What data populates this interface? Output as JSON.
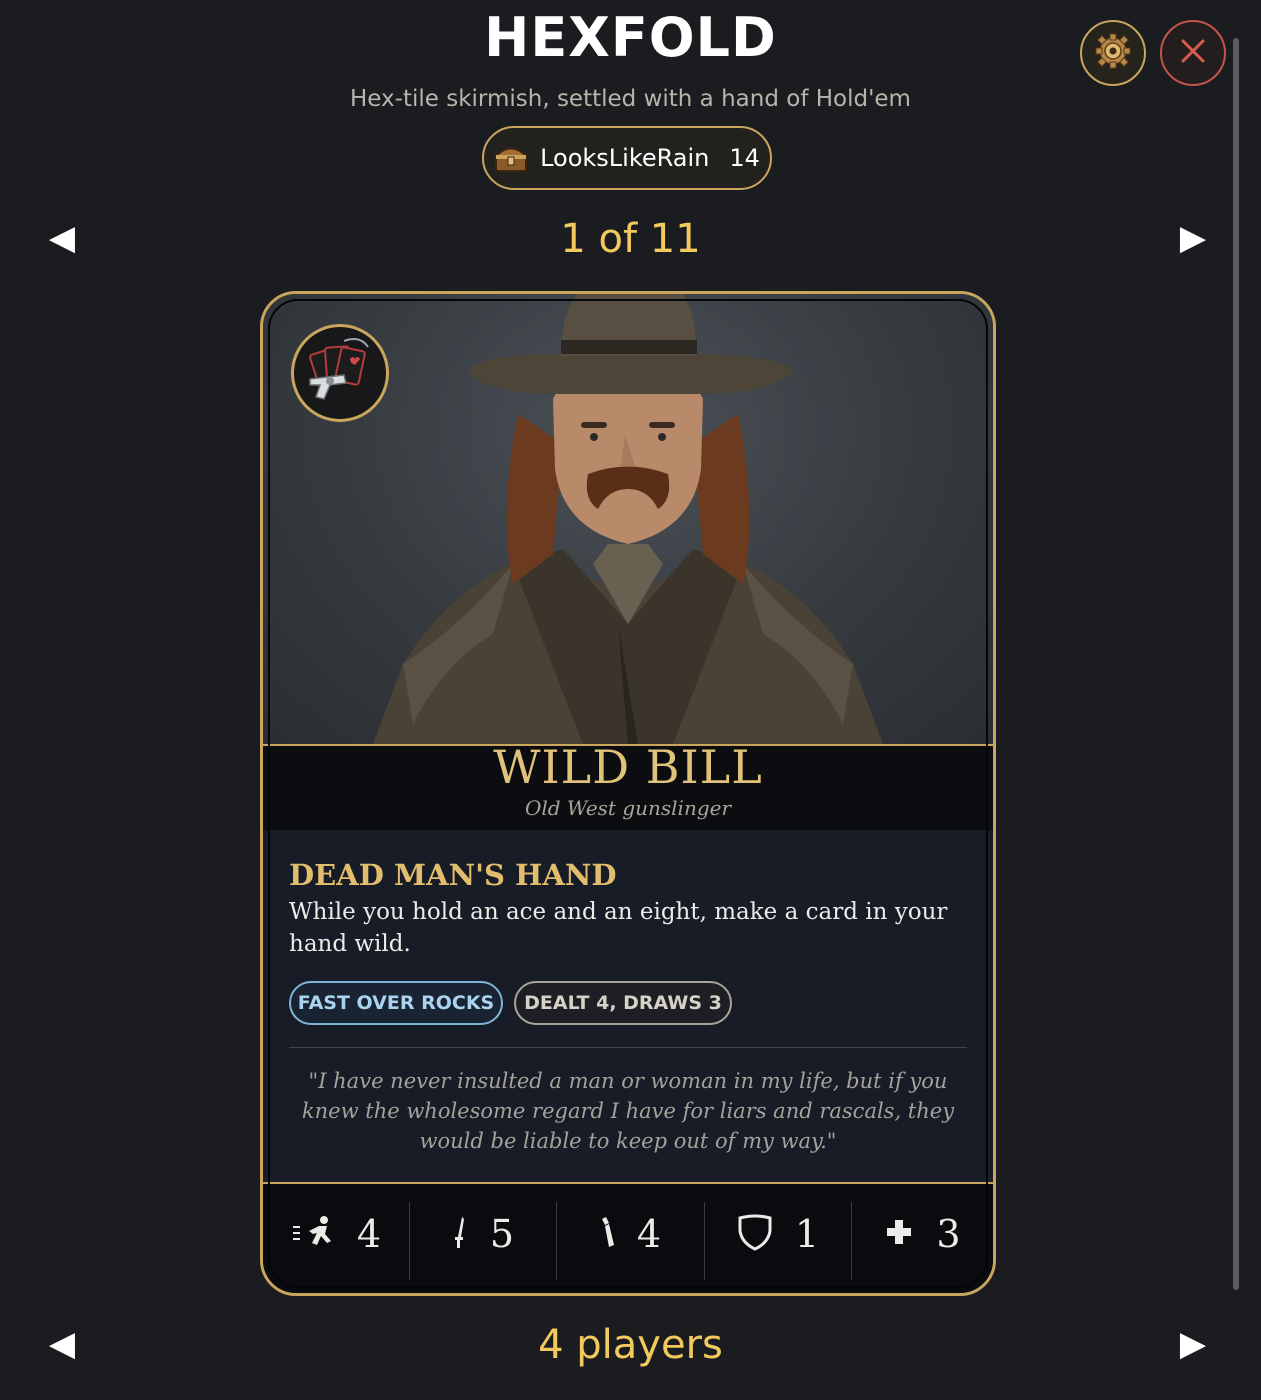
{
  "header": {
    "title": "HEXFOLD",
    "subtitle": "Hex-tile skirmish, settled with a hand of Hold'em"
  },
  "user": {
    "icon": "treasure-chest-icon",
    "name": "LooksLikeRain",
    "count": "14"
  },
  "controls": {
    "settings_icon": "gear-icon",
    "close_icon": "close-icon",
    "prev_icon": "◀",
    "next_icon": "▶"
  },
  "pager": {
    "counter": "1 of 11"
  },
  "card": {
    "name": "WILD BILL",
    "subtitle": "Old West gunslinger",
    "emblem_icon": "revolver-and-cards-icon",
    "ability": {
      "title": "DEAD MAN'S HAND",
      "text": "While you hold an ace and an eight, make a card in your hand wild."
    },
    "tags": [
      "FAST OVER ROCKS",
      "DEALT 4, DRAWS 3"
    ],
    "quote": "\"I have never insulted a man or woman in my life, but if you knew the wholesome regard I have for liars and rascals, they would be liable to keep out of my way.\"",
    "stats": [
      {
        "icon": "running-man-icon",
        "value": "4"
      },
      {
        "icon": "dagger-icon",
        "value": "5"
      },
      {
        "icon": "bullet-icon",
        "value": "4"
      },
      {
        "icon": "shield-icon",
        "value": "1"
      },
      {
        "icon": "cross-icon",
        "value": "3"
      }
    ]
  },
  "players_selector": {
    "label": "4 players"
  },
  "colors": {
    "accent_gold": "#c9a55e",
    "highlight_yellow": "#f1c95d",
    "close_red": "#c4534a",
    "background": "#1b1c20"
  }
}
